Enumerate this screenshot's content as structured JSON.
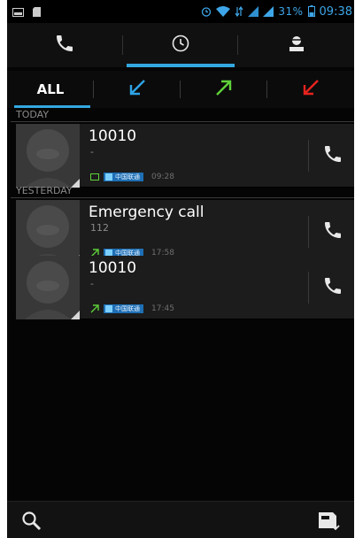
{
  "status_bar": {
    "battery_text": "31%",
    "clock": "09:38"
  },
  "top_tabs": [
    {
      "icon": "phone-icon"
    },
    {
      "icon": "clock-icon",
      "selected": true
    },
    {
      "icon": "contact-icon"
    }
  ],
  "filter_tabs": {
    "all_label": "ALL",
    "incoming_icon": "incoming-arrow-icon",
    "outgoing_icon": "outgoing-arrow-icon",
    "missed_icon": "missed-arrow-icon",
    "colors": {
      "incoming": "#2ea4e6",
      "outgoing": "#5fd13a",
      "missed": "#e8231e",
      "accent": "#33a8e0"
    }
  },
  "sections": {
    "today": "TODAY",
    "yesterday": "YESTERDAY"
  },
  "calls": [
    {
      "name": "10010",
      "number": "-",
      "carrier": "中国联通",
      "time": "09:28",
      "type": "sms"
    },
    {
      "name": "Emergency call",
      "number": "112",
      "carrier": "中国联通",
      "time": "17:58",
      "type": "outgoing"
    },
    {
      "name": "10010",
      "number": "-",
      "carrier": "中国联通",
      "time": "17:45",
      "type": "outgoing"
    }
  ]
}
